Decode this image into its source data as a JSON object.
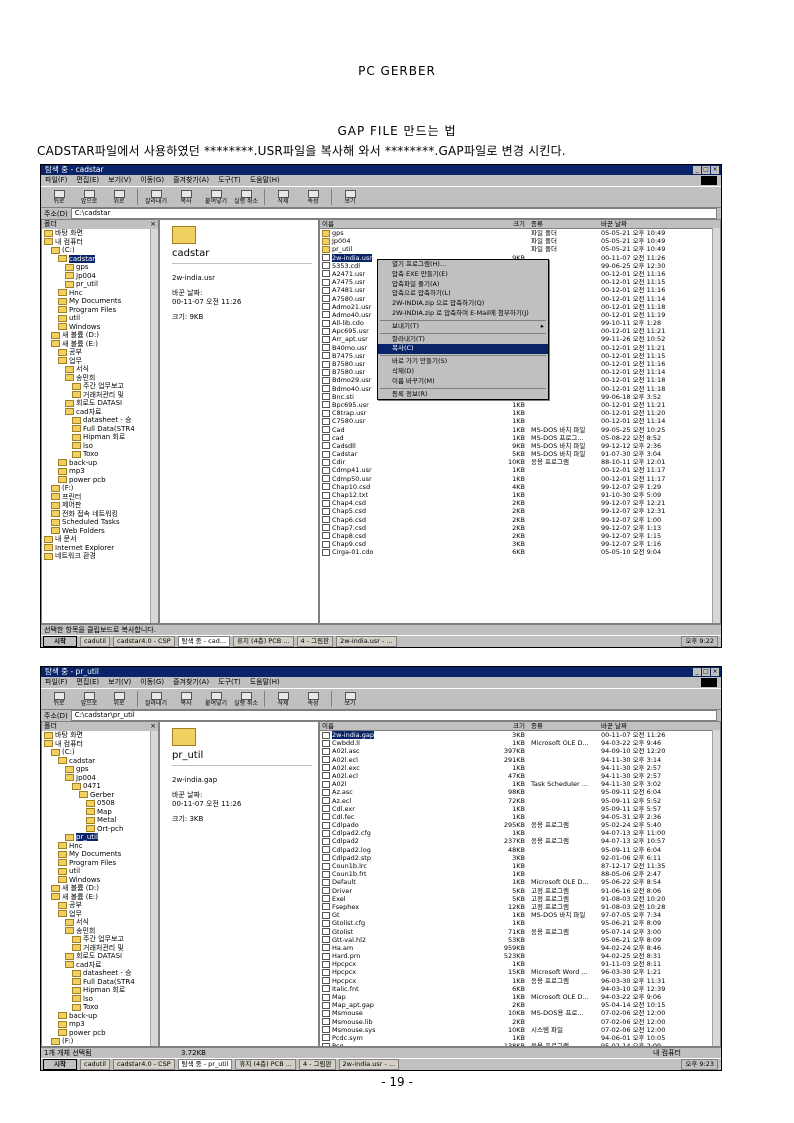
{
  "page": {
    "header": "PC GERBER",
    "title": "GAP FILE 만드는 법",
    "instruction": "CADSTAR파일에서 사용하였던 ********.USR파일을 복사해 와서 ********.GAP파일로 변경 시킨다.",
    "page_number": "- 19 -"
  },
  "window1": {
    "title": "탐색 중 - cadstar",
    "menu": [
      "파일(F)",
      "편집(E)",
      "보기(V)",
      "이동(G)",
      "즐겨찾기(A)",
      "도구(T)",
      "도움말(H)"
    ],
    "toolbar": [
      "뒤로",
      "앞으로",
      "위로",
      "잘라내기",
      "복사",
      "붙여넣기",
      "실행 취소",
      "삭제",
      "속성",
      "보기"
    ],
    "address_label": "주소(D)",
    "address": "C:\\cadstar",
    "tree_header": "폴더",
    "tree": [
      "바탕 화면",
      "내 컴퓨터",
      "(C:)",
      "cadstar",
      "gps",
      "Jp004",
      "pr_util",
      "Hnc",
      "My Documents",
      "Program Files",
      "util",
      "Windows",
      "새 볼륨 (D:)",
      "새 볼륨 (E:)",
      "공부",
      "업무",
      "서식",
      "송민희",
      "주간 업무보고",
      "거래처관리 및",
      "회로도 DATASI",
      "cad자료",
      "datasheet - 승",
      "Full Data(STR4",
      "Hipman 회로",
      "lso",
      "Toxo",
      "back-up",
      "mp3",
      "power pcb",
      "(F:)",
      "프린터",
      "제어판",
      "전화 접속 네트워킹",
      "Scheduled Tasks",
      "Web Folders",
      "내 문서",
      "Internet Explorer",
      "네트워크 환경"
    ],
    "info": {
      "folder": "cadstar",
      "file": "2w-india.usr",
      "modified_label": "바꾼 날짜:",
      "modified": "00-11-07 오전 11:26",
      "size_label": "크기: 9KB"
    },
    "columns": [
      "이름",
      "크기",
      "종류",
      "바꾼 날짜"
    ],
    "files": [
      [
        "gps",
        "",
        "파일 폴더",
        "05-05-21 오후 10:49"
      ],
      [
        "Jp004",
        "",
        "파일 폴더",
        "05-05-21 오후 10:49"
      ],
      [
        "pr_util",
        "",
        "파일 폴더",
        "05-05-21 오후 10:49"
      ],
      [
        "2w-india.usr",
        "9KB",
        "",
        "00-11-07 오전 11:26"
      ],
      [
        "5353.cdl",
        "",
        "",
        "99-06-25 오후 12:30"
      ],
      [
        "A2471.usr",
        "",
        "",
        "00-12-01 오전 11:16"
      ],
      [
        "A7475.usr",
        "",
        "",
        "00-12-01 오전 11:15"
      ],
      [
        "A7481.usr",
        "",
        "",
        "00-12-01 오전 11:16"
      ],
      [
        "A7580.usr",
        "",
        "",
        "00-12-01 오전 11:14"
      ],
      [
        "Admo21.usr",
        "",
        "",
        "00-12-01 오전 11:18"
      ],
      [
        "Admo40.usr",
        "",
        "",
        "00-12-01 오전 11:19"
      ],
      [
        "All-lib.cdo",
        "",
        "",
        "99-10-11 오후 1:28"
      ],
      [
        "Apc695.usr",
        "",
        "",
        "00-12-01 오전 11:21"
      ],
      [
        "Arr_apt.usr",
        "",
        "",
        "99-11-26 오전 10:52"
      ],
      [
        "B40mo.usr",
        "",
        "",
        "00-12-01 오전 11:21"
      ],
      [
        "B7475.usr",
        "",
        "",
        "00-12-01 오전 11:15"
      ],
      [
        "B7580.usr",
        "",
        "",
        "00-12-01 오전 11:16"
      ],
      [
        "B7580.usr",
        "",
        "",
        "00-12-01 오전 11:14"
      ],
      [
        "Bdmo29.usr",
        "",
        "",
        "00-12-01 오전 11:18"
      ],
      [
        "Bdmo40.usr",
        "1KB",
        "",
        "00-12-01 오전 11:18"
      ],
      [
        "Bnc.sti",
        "1KB",
        "",
        "99-06-18 오후 3:52"
      ],
      [
        "Bpc695.usr",
        "1KB",
        "",
        "00-12-01 오전 11:21"
      ],
      [
        "C8trap.usr",
        "1KB",
        "",
        "00-12-01 오전 11:20"
      ],
      [
        "C7580.usr",
        "1KB",
        "",
        "00-12-01 오전 11:14"
      ],
      [
        "Cad",
        "1KB",
        "MS-DOS 바치 파일",
        "99-05-25 오전 10:25"
      ],
      [
        "cad",
        "1KB",
        "MS-DOS 프로그...",
        "05-08-22 오전 8:52"
      ],
      [
        "Cadsdll",
        "9KB",
        "MS-DOS 바치 파일",
        "99-12-12 오후 2:36"
      ],
      [
        "Cadstar",
        "5KB",
        "MS-DOS 바치 파일",
        "91-07-30 오후 3:04"
      ],
      [
        "Cdir",
        "10KB",
        "응용 프로그램",
        "88-10-11 오후 12:01"
      ],
      [
        "Cdmp41.usr",
        "1KB",
        "",
        "00-12-01 오전 11:17"
      ],
      [
        "Cdmp50.usr",
        "1KB",
        "",
        "00-12-01 오전 11:17"
      ],
      [
        "Chap10.csd",
        "4KB",
        "",
        "99-12-07 오후 1:29"
      ],
      [
        "Chap12.txt",
        "1KB",
        "",
        "91-10-30 오후 5:09"
      ],
      [
        "Chap4.csd",
        "2KB",
        "",
        "99-12-07 오후 12:21"
      ],
      [
        "Chap5.csd",
        "2KB",
        "",
        "99-12-07 오후 12:31"
      ],
      [
        "Chap6.csd",
        "2KB",
        "",
        "99-12-07 오후 1:00"
      ],
      [
        "Chap7.csd",
        "2KB",
        "",
        "99-12-07 오후 1:13"
      ],
      [
        "Chap8.csd",
        "2KB",
        "",
        "99-12-07 오후 1:15"
      ],
      [
        "Chap9.csd",
        "3KB",
        "",
        "99-12-07 오후 1:16"
      ],
      [
        "Cirga-01.cdo",
        "6KB",
        "",
        "05-05-10 오전 9:04"
      ]
    ],
    "context_menu": [
      "열기 프로그램(H)...",
      "압축 EXE 만들기(E)",
      "압축파일 풀기(A)",
      "압축으로 압축하기(L)",
      "2W-INDIA.zip 으로 압축하기(Q)",
      "2W-INDIA.zip 로 압축하여 E-Mail에 첨부하기(J)",
      "보내기(T)",
      "잘라내기(T)",
      "복사(C)",
      "바로 가기 만들기(S)",
      "삭제(D)",
      "이름 바꾸기(M)",
      "등록 정보(R)"
    ],
    "status": "선택한 항목을 클립보드로 복사합니다.",
    "taskbar": [
      "시작",
      "cadutil",
      "cadstar4.0 - CSP",
      "탐색 중 - cad...",
      "휴지 (4층) PCB ...",
      "4 - 그림판",
      "2w-india.usr - ..."
    ],
    "clock": "오후 9:22"
  },
  "window2": {
    "title": "탐색 중 - pr_util",
    "menu": [
      "파일(F)",
      "편집(E)",
      "보기(V)",
      "이동(G)",
      "즐겨찾기(A)",
      "도구(T)",
      "도움말(H)"
    ],
    "toolbar": [
      "뒤로",
      "앞으로",
      "위로",
      "잘라내기",
      "복사",
      "붙여넣기",
      "실행 취소",
      "삭제",
      "속성",
      "보기"
    ],
    "address_label": "주소(D)",
    "address": "C:\\cadstar\\pr_util",
    "tree_header": "폴더",
    "tree": [
      "바탕 화면",
      "내 컴퓨터",
      "(C:)",
      "cadstar",
      "gps",
      "Jp004",
      "0471",
      "Gerber",
      "0508",
      "Map",
      "Metal",
      "Ort-pch",
      "pr_util",
      "Hnc",
      "My Documents",
      "Program Files",
      "util",
      "Windows",
      "새 볼륨 (D:)",
      "새 볼륨 (E:)",
      "공부",
      "업무",
      "서식",
      "송민희",
      "주간 업무보고",
      "거래처관리 및",
      "회로도 DATASI",
      "cad자료",
      "datasheet - 승",
      "Full Data(STR4",
      "Hipman 회로",
      "lso",
      "Toxo",
      "back-up",
      "mp3",
      "power pcb",
      "(F:)",
      "프린터",
      "제어판"
    ],
    "info": {
      "folder": "pr_util",
      "file": "2w-india.gap",
      "modified_label": "바꾼 날짜:",
      "modified": "00-11-07 오전 11:26",
      "size_label": "크기: 3KB"
    },
    "columns": [
      "이름",
      "크기",
      "종류",
      "바꾼 날짜"
    ],
    "files": [
      [
        "2w-india.gap",
        "3KB",
        "",
        "00-11-07 오전 11:26"
      ],
      [
        "Cwbdd.ll",
        "1KB",
        "Microsoft OLE D...",
        "94-03-22 오후 9:46"
      ],
      [
        "A02l.asc",
        "397KB",
        "",
        "94-09-10 오전 12:20"
      ],
      [
        "A02l.ecl",
        "291KB",
        "",
        "94-11-30 오후 3:14"
      ],
      [
        "A02l.exc",
        "1KB",
        "",
        "94-11-30 오후 2:57"
      ],
      [
        "A02l.ecl",
        "47KB",
        "",
        "94-11-30 오후 2:57"
      ],
      [
        "A02l",
        "1KB",
        "Task Scheduler ...",
        "94-11-30 오후 3:02"
      ],
      [
        "Az.asc",
        "98KB",
        "",
        "95-09-11 오전 6:04"
      ],
      [
        "Az.ecl",
        "72KB",
        "",
        "95-09-11 오후 5:52"
      ],
      [
        "Cdl.exr",
        "1KB",
        "",
        "95-09-11 오후 5:57"
      ],
      [
        "Cdl.fec",
        "1KB",
        "",
        "94-05-31 오후 2:36"
      ],
      [
        "Cdlpado",
        "295KB",
        "응용 프로그램",
        "95-02-24 오후 5:40"
      ],
      [
        "Cdlpad2.cfg",
        "1KB",
        "",
        "94-07-13 오후 11:00"
      ],
      [
        "Cdlpad2",
        "237KB",
        "응용 프로그램",
        "94-07-13 오후 10:57"
      ],
      [
        "Cdlpad2.log",
        "48KB",
        "",
        "95-09-11 오후 6:04"
      ],
      [
        "Cdlpad2.stp",
        "3KB",
        "",
        "92-01-06 오후 6:11"
      ],
      [
        "Coun1b.lrc",
        "1KB",
        "",
        "87-12-17 오전 11:35"
      ],
      [
        "Coun1b.frt",
        "1KB",
        "",
        "88-05-06 오후 2:47"
      ],
      [
        "Default",
        "1KB",
        "Microsoft OLE D...",
        "95-06-22 오후 8:54"
      ],
      [
        "Driver",
        "5KB",
        "고정 프로그램",
        "91-06-16 오전 8:06"
      ],
      [
        "Exel",
        "5KB",
        "고정 프로그램",
        "91-08-03 오전 10:20"
      ],
      [
        "Fsephex",
        "12KB",
        "고정 프로그램",
        "91-08-03 오전 10:28"
      ],
      [
        "Gt",
        "1KB",
        "MS-DOS 바치 파일",
        "97-07-05 오후 7:34"
      ],
      [
        "Gtolist.cfg",
        "1KB",
        "",
        "95-06-21 오후 8:09"
      ],
      [
        "Gtolist",
        "71KB",
        "응용 프로그램",
        "95-07-14 오후 3:00"
      ],
      [
        "Gtt-val.hl2",
        "53KB",
        "",
        "95-06-21 오후 8:09"
      ],
      [
        "Ha.am",
        "959KB",
        "",
        "94-02-24 오후 8:46"
      ],
      [
        "Hard.prn",
        "523KB",
        "",
        "94-02-25 오전 8:31"
      ],
      [
        "Hpcpcx",
        "1KB",
        "",
        "91-11-03 오전 8:11"
      ],
      [
        "Hpcpcx",
        "15KB",
        "Microsoft Word ...",
        "96-03-30 오후 1:21"
      ],
      [
        "Hpcpcx",
        "1KB",
        "응용 프로그램",
        "96-03-30 오후 11:31"
      ],
      [
        "Italic.fnt",
        "6KB",
        "",
        "94-03-10 오후 12:39"
      ],
      [
        "Map",
        "1KB",
        "Microsoft OLE D...",
        "94-03-22 오후 9:06"
      ],
      [
        "Map_apt.gap",
        "2KB",
        "",
        "95-04-14 오전 10:15"
      ],
      [
        "Msmouse",
        "10KB",
        "MS-DOS용 프로...",
        "07-02-06 오전 12:00"
      ],
      [
        "Msmouse.lib",
        "2KB",
        "",
        "07-02-06 오전 12:00"
      ],
      [
        "Msmouse.sys",
        "10KB",
        "시스템 파일",
        "07-02-06 오전 12:00"
      ],
      [
        "Pcdc.sym",
        "1KB",
        "",
        "94-06-01 오후 10:05"
      ],
      [
        "Pcg",
        "138KB",
        "응용 프로그램",
        "95-02-14 오후 2:09"
      ],
      [
        "Pcgdiv",
        "128KB",
        "응용 프로그램",
        "95-09-03 오전 10:25"
      ],
      [
        "Pcgerber",
        "159KB",
        "응용 프로그램",
        "95-07-11 오후 10:46"
      ]
    ],
    "status_left": "1개 개체 선택됨",
    "status_mid": "3.72KB",
    "status_right": "내 컴퓨터",
    "taskbar": [
      "시작",
      "cadutil",
      "cadstar4.0 - CSP",
      "탐색 중 - pr_util",
      "휴지 (4층) PCB ...",
      "4 - 그림판",
      "2w-india.usr - ..."
    ],
    "clock": "오후 9:23"
  }
}
